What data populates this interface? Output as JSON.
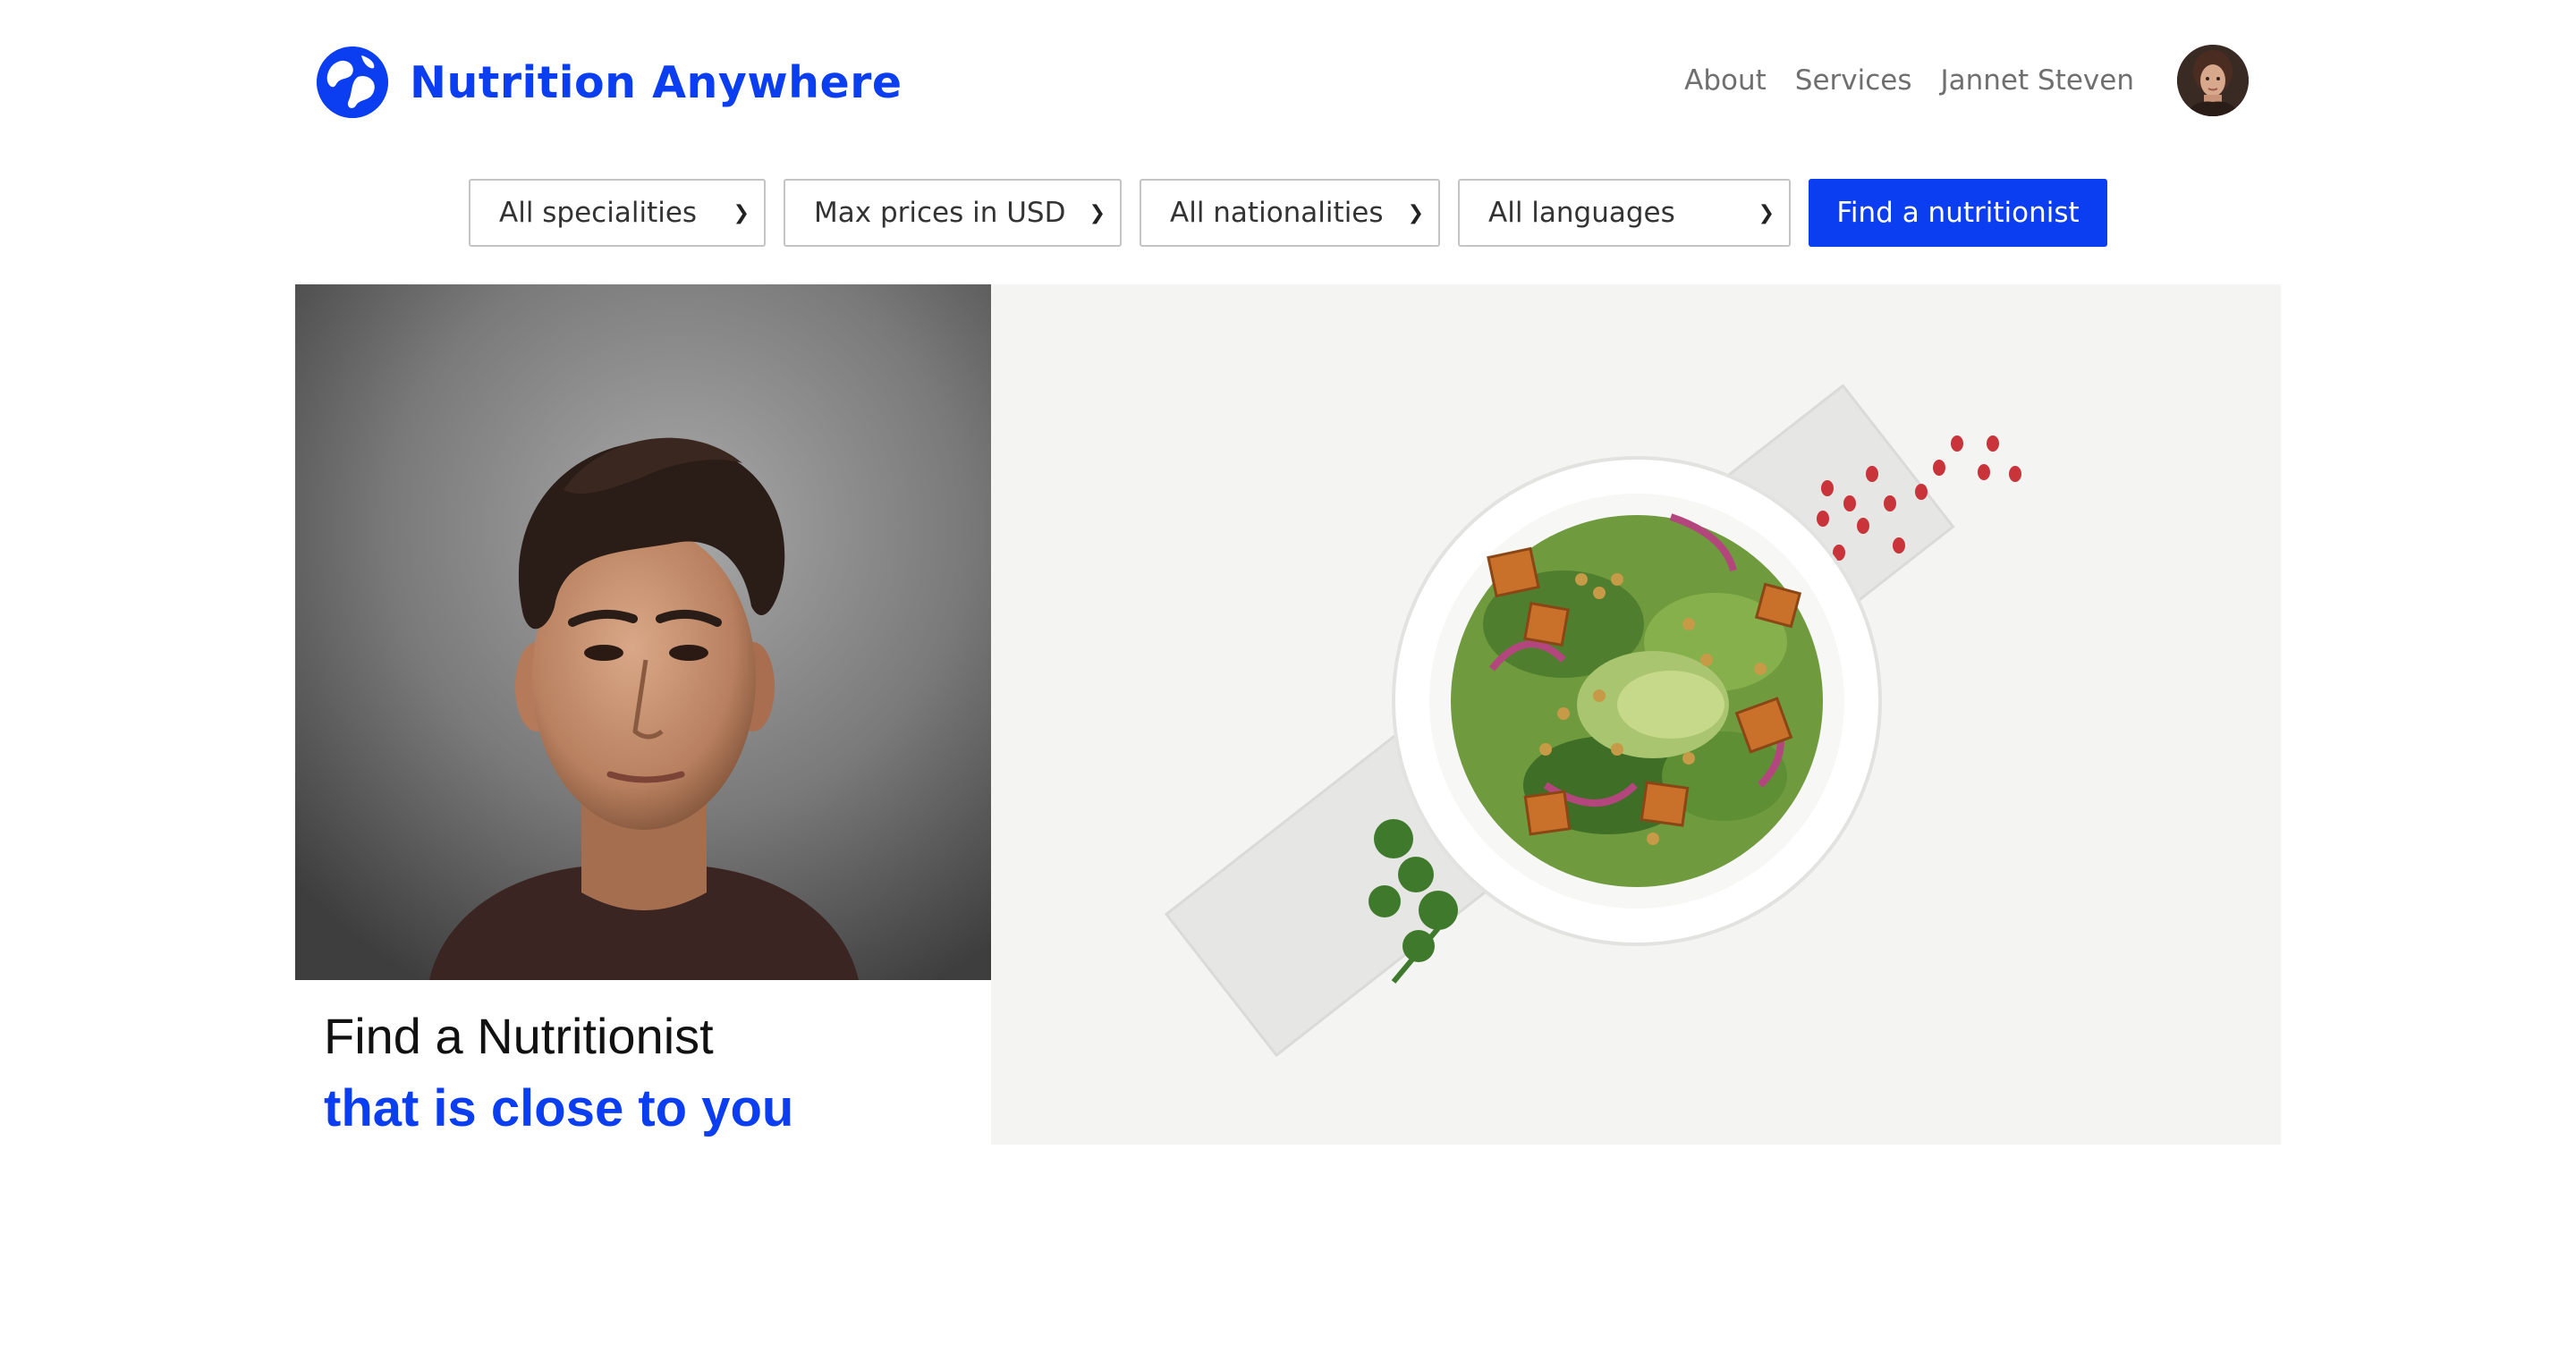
{
  "brand": {
    "name": "Nutrition Anywhere",
    "logo_icon": "globe-logo-icon",
    "accent_color": "#0b3ef0"
  },
  "nav": {
    "about": "About",
    "services": "Services",
    "user_name": "Jannet Steven",
    "avatar_icon": "user-avatar"
  },
  "filters": {
    "speciality": "All specialities",
    "max_price": "Max prices in USD",
    "nationality": "All nationalities",
    "language": "All languages",
    "submit_label": "Find a nutritionist"
  },
  "hero": {
    "title": "Find a Nutritionist",
    "subtitle": "that is close to you"
  }
}
